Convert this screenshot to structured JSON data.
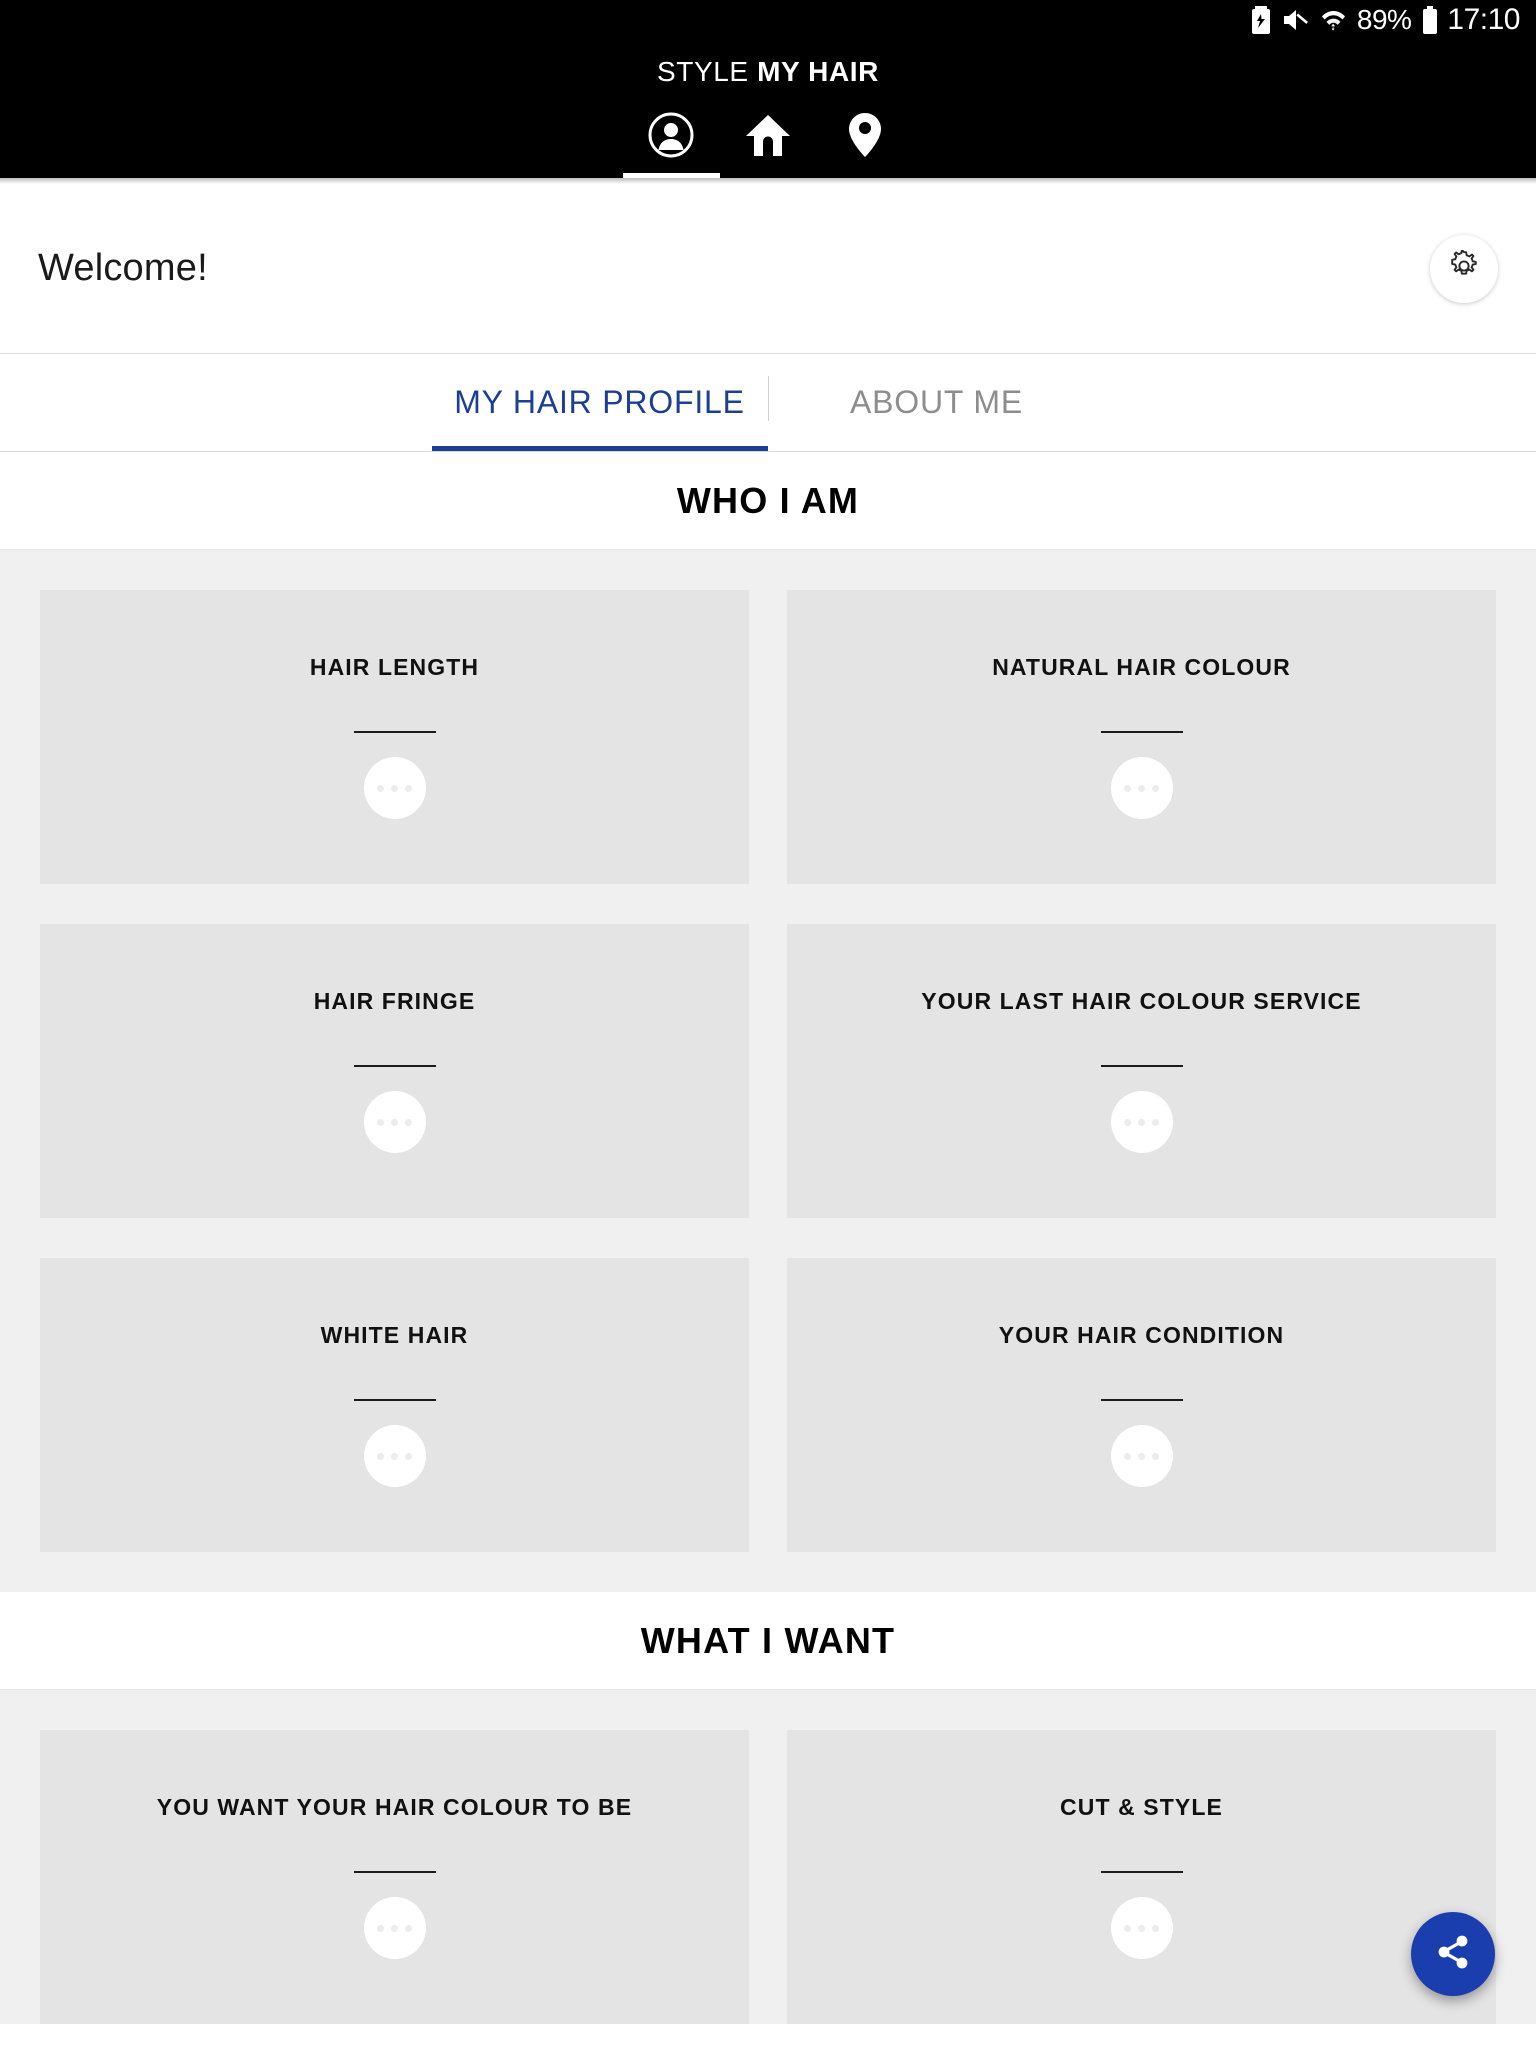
{
  "status_bar": {
    "battery_saver_icon": "battery-saver-icon",
    "mute_icon": "volume-mute-icon",
    "wifi_icon": "wifi-icon",
    "battery_percent": "89%",
    "battery_icon": "battery-icon",
    "clock": "17:10"
  },
  "app_bar": {
    "title_light": "STYLE ",
    "title_bold": "MY HAIR",
    "nav": [
      {
        "name": "account",
        "icon": "account-circle-icon",
        "active": true
      },
      {
        "name": "home",
        "icon": "home-icon",
        "active": false
      },
      {
        "name": "locator",
        "icon": "location-pin-icon",
        "active": false
      }
    ]
  },
  "welcome": {
    "greeting": "Welcome!",
    "settings_icon": "gear-icon"
  },
  "tabs": [
    {
      "label": "MY HAIR PROFILE",
      "active": true
    },
    {
      "label": "ABOUT ME",
      "active": false
    }
  ],
  "sections": [
    {
      "heading": "WHO I AM",
      "rows": [
        [
          {
            "title": "HAIR LENGTH"
          },
          {
            "title": "NATURAL HAIR COLOUR"
          }
        ],
        [
          {
            "title": "HAIR FRINGE"
          },
          {
            "title": "YOUR LAST HAIR COLOUR SERVICE"
          }
        ],
        [
          {
            "title": "WHITE HAIR"
          },
          {
            "title": "YOUR HAIR CONDITION"
          }
        ]
      ]
    },
    {
      "heading": "WHAT I WANT",
      "rows": [
        [
          {
            "title": "YOU WANT YOUR HAIR COLOUR TO BE"
          },
          {
            "title": "CUT & STYLE"
          }
        ]
      ]
    }
  ],
  "fab": {
    "icon": "share-icon",
    "color": "#1a3ead"
  },
  "colors": {
    "appbar_bg": "#000000",
    "accent_blue": "#1c3f94",
    "card_bg": "#e4e4e4",
    "page_bg": "#f0f0f0",
    "tab_inactive": "#8d8d8d"
  }
}
